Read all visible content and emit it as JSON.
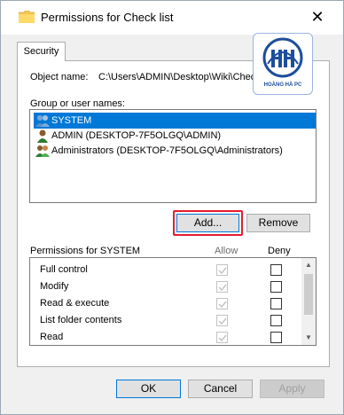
{
  "window": {
    "title": "Permissions for Check list",
    "close_symbol": "✕",
    "folder_icon": "folder-icon"
  },
  "tabs": [
    {
      "label": "Security",
      "selected": true
    }
  ],
  "logo": {
    "caption": "HOÀNG HÀ PC",
    "monogram": "HH",
    "color": "#1c4e9c"
  },
  "object": {
    "label": "Object name:",
    "value": "C:\\Users\\ADMIN\\Desktop\\Wiki\\Check list"
  },
  "groups": {
    "label": "Group or user names:",
    "items": [
      {
        "name": "SYSTEM",
        "icon": "group-users-icon",
        "selected": true
      },
      {
        "name": "ADMIN (DESKTOP-7F5OLGQ\\ADMIN)",
        "icon": "user-icon",
        "selected": false
      },
      {
        "name": "Administrators (DESKTOP-7F5OLGQ\\Administrators)",
        "icon": "group-users-icon",
        "selected": false
      }
    ]
  },
  "buttons": {
    "add": "Add...",
    "remove": "Remove",
    "ok": "OK",
    "cancel": "Cancel",
    "apply": "Apply"
  },
  "permissions": {
    "label": "Permissions for SYSTEM",
    "allow_header": "Allow",
    "deny_header": "Deny",
    "items": [
      {
        "name": "Full control",
        "allow": true,
        "deny": false
      },
      {
        "name": "Modify",
        "allow": true,
        "deny": false
      },
      {
        "name": "Read & execute",
        "allow": true,
        "deny": false
      },
      {
        "name": "List folder contents",
        "allow": true,
        "deny": false
      },
      {
        "name": "Read",
        "allow": true,
        "deny": false
      },
      {
        "name": "",
        "allow": true,
        "deny": false
      }
    ]
  },
  "colors": {
    "selection": "#0078d7",
    "highlight_box": "#e51d2e"
  }
}
